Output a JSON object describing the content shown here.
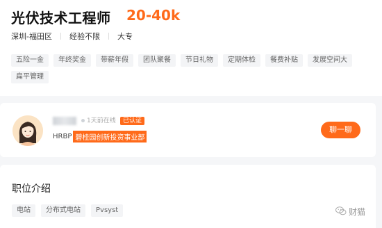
{
  "job": {
    "title": "光伏技术工程师",
    "salary": "20-40k",
    "location": "深圳-福田区",
    "experience": "经验不限",
    "education": "大专"
  },
  "benefits": [
    "五险一金",
    "年终奖金",
    "带薪年假",
    "团队聚餐",
    "节日礼物",
    "定期体检",
    "餐费补贴",
    "发展空间大",
    "扁平管理"
  ],
  "recruiter": {
    "online_status": "1天前在线",
    "verified_badge": "已认证",
    "role": "HRBP",
    "company": "碧桂园创新投资事业部",
    "chat_button": "聊一聊"
  },
  "description": {
    "title": "职位介绍",
    "keywords": [
      "电站",
      "分布式电站",
      "Pvsyst"
    ]
  },
  "watermark": "财猫",
  "colors": {
    "accent": "#ff6a1a"
  }
}
